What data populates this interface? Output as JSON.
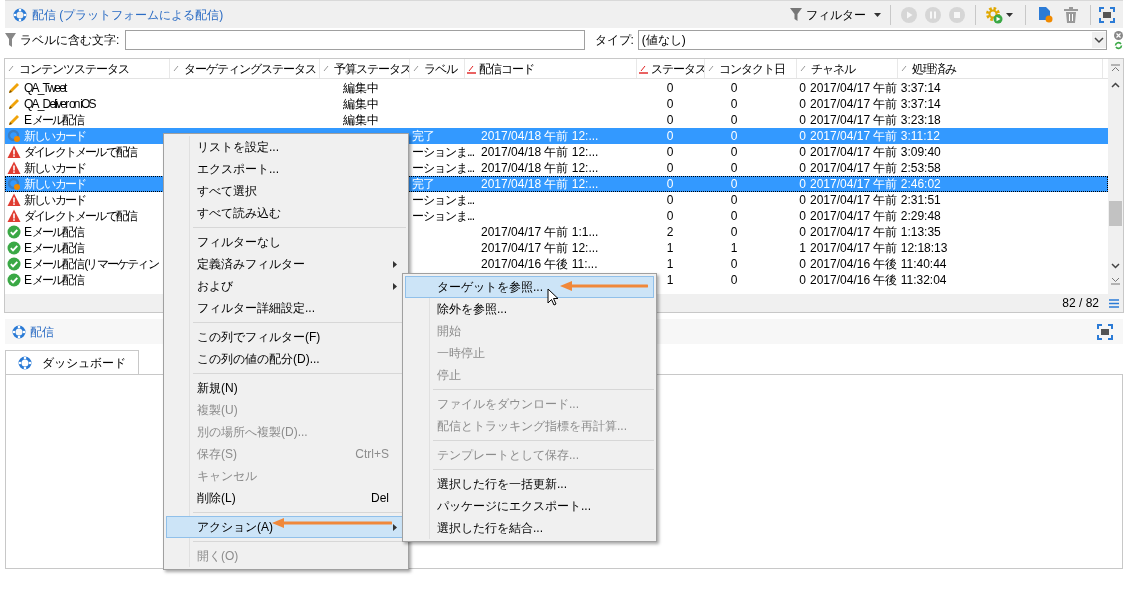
{
  "header": {
    "title": "配信 (プラットフォームによる配信)",
    "filter_button": "フィルター"
  },
  "filter_bar": {
    "text_filter_label": "ラベルに含む文字:",
    "type_filter_label": "タイプ:",
    "type_filter_value": "(値なし)"
  },
  "table": {
    "columns": [
      {
        "label": "コンテンツステータス",
        "sorted": false
      },
      {
        "label": "ターゲティングステータス",
        "sorted": false
      },
      {
        "label": "予算ステータス",
        "sorted": false
      },
      {
        "label": "ラベル",
        "sorted": false
      },
      {
        "label": "配信コード",
        "sorted": true
      },
      {
        "label": "ステータス",
        "sorted": true
      },
      {
        "label": "コンタクト日",
        "sorted": false
      },
      {
        "label": "チャネル",
        "sorted": false
      },
      {
        "label": "処理済み",
        "sorted": false
      }
    ],
    "rows": [
      {
        "kind": "editing",
        "name": "QA_Tweet",
        "budget": "編集中",
        "status": "0",
        "contact": "0",
        "channel": "0",
        "processed": "2017/04/17 午前 3:37:14",
        "selected": false,
        "focused": false
      },
      {
        "kind": "editing",
        "name": "QA_Deliver on iOS",
        "budget": "編集中",
        "status": "0",
        "contact": "0",
        "channel": "0",
        "processed": "2017/04/17 午前 3:37:14",
        "selected": false,
        "focused": false
      },
      {
        "kind": "editing",
        "name": "E メール配信",
        "budget": "編集中",
        "status": "0",
        "contact": "0",
        "channel": "0",
        "processed": "2017/04/17 午前 3:23:18",
        "selected": false,
        "focused": false
      },
      {
        "kind": "targeting",
        "name": "新しいカード",
        "targeting": "完了",
        "code": "2017/04/18 午前 12:...",
        "status": "0",
        "contact": "0",
        "channel": "0",
        "processed": "2017/04/17 午前 3:11:12",
        "selected": true,
        "focused": false
      },
      {
        "kind": "warning",
        "name": "ダイレクトメールで配信",
        "targeting": "ーションま...",
        "code": "2017/04/18 午前 12:...",
        "status": "0",
        "contact": "0",
        "channel": "0",
        "processed": "2017/04/17 午前 3:09:40",
        "selected": false,
        "focused": false
      },
      {
        "kind": "warning",
        "name": "新しいカード",
        "targeting": "ーションま...",
        "code": "2017/04/18 午前 12:...",
        "status": "0",
        "contact": "0",
        "channel": "0",
        "processed": "2017/04/17 午前 2:53:58",
        "selected": false,
        "focused": false
      },
      {
        "kind": "targeting",
        "name": "新しいカード",
        "targeting": "完了",
        "code": "2017/04/18 午前 12:...",
        "status": "0",
        "contact": "0",
        "channel": "0",
        "processed": "2017/04/17 午前 2:46:02",
        "selected": true,
        "focused": true
      },
      {
        "kind": "warning",
        "name": "新しいカード",
        "targeting": "ーションま...",
        "status": "0",
        "contact": "0",
        "channel": "0",
        "processed": "2017/04/17 午前 2:31:51",
        "selected": false,
        "focused": false
      },
      {
        "kind": "warning",
        "name": "ダイレクトメールで配信",
        "targeting": "ーションま...",
        "status": "0",
        "contact": "0",
        "channel": "0",
        "processed": "2017/04/17 午前 2:29:48",
        "selected": false,
        "focused": false
      },
      {
        "kind": "done",
        "name": "E メール配信",
        "code": "2017/04/17 午前 1:1...",
        "status": "2",
        "contact": "0",
        "channel": "0",
        "processed": "2017/04/17 午前 1:13:35",
        "selected": false,
        "focused": false
      },
      {
        "kind": "done",
        "name": "E メール配信",
        "code": "2017/04/17 午前 12:...",
        "status": "1",
        "contact": "1",
        "channel": "1",
        "processed": "2017/04/17 午前 12:18:13",
        "selected": false,
        "focused": false
      },
      {
        "kind": "done",
        "name": "E メール配信 (リマーケティン",
        "code": "2017/04/16 午後 11:...",
        "status": "1",
        "contact": "0",
        "channel": "0",
        "processed": "2017/04/16 午後 11:40:44",
        "selected": false,
        "focused": false
      },
      {
        "kind": "done",
        "name": "E メール配信",
        "status": "1",
        "contact": "0",
        "channel": "0",
        "processed": "2017/04/16 午後 11:32:04",
        "selected": false,
        "focused": false
      }
    ],
    "count": "82 / 82"
  },
  "lower_panel": {
    "title": "配信",
    "tabs": [
      {
        "label": "ダッシュボード",
        "selected": true
      }
    ]
  },
  "context_menu": {
    "items": [
      {
        "kind": "item",
        "label": "リストを設定...",
        "disabled": false,
        "selected": false,
        "submenu": false
      },
      {
        "kind": "item",
        "label": "エクスポート...",
        "disabled": false,
        "selected": false,
        "submenu": false
      },
      {
        "kind": "item",
        "label": "すべて選択",
        "disabled": false,
        "selected": false,
        "submenu": false
      },
      {
        "kind": "item",
        "label": "すべて読み込む",
        "disabled": false,
        "selected": false,
        "submenu": false
      },
      {
        "kind": "separator"
      },
      {
        "kind": "item",
        "label": "フィルターなし",
        "disabled": false,
        "selected": false,
        "submenu": false
      },
      {
        "kind": "item",
        "label": "定義済みフィルター",
        "disabled": false,
        "selected": false,
        "submenu": true
      },
      {
        "kind": "item",
        "label": "および",
        "disabled": false,
        "selected": false,
        "submenu": true
      },
      {
        "kind": "item",
        "label": "フィルター詳細設定...",
        "disabled": false,
        "selected": false,
        "submenu": false
      },
      {
        "kind": "separator"
      },
      {
        "kind": "item",
        "label": "この列でフィルター(F)",
        "disabled": false,
        "selected": false,
        "submenu": false
      },
      {
        "kind": "item",
        "label": "この列の値の配分(D)...",
        "disabled": false,
        "selected": false,
        "submenu": false
      },
      {
        "kind": "separator"
      },
      {
        "kind": "item",
        "label": "新規(N)",
        "disabled": false,
        "selected": false,
        "submenu": false
      },
      {
        "kind": "item",
        "label": "複製(U)",
        "disabled": true,
        "selected": false,
        "submenu": false
      },
      {
        "kind": "item",
        "label": "別の場所へ複製(D)...",
        "disabled": true,
        "selected": false,
        "submenu": false
      },
      {
        "kind": "item",
        "label": "保存(S)",
        "shortcut": "Ctrl+S",
        "disabled": true,
        "selected": false,
        "submenu": false
      },
      {
        "kind": "item",
        "label": "キャンセル",
        "disabled": true,
        "selected": false,
        "submenu": false
      },
      {
        "kind": "item",
        "label": "削除(L)",
        "shortcut": "Del",
        "disabled": false,
        "selected": false,
        "submenu": false
      },
      {
        "kind": "separator"
      },
      {
        "kind": "item",
        "label": "アクション(A)",
        "disabled": false,
        "selected": true,
        "submenu": true
      },
      {
        "kind": "separator"
      },
      {
        "kind": "item",
        "label": "開く(O)",
        "disabled": true,
        "selected": false,
        "submenu": false
      }
    ]
  },
  "submenu": {
    "items": [
      {
        "kind": "item",
        "label": "ターゲットを参照...",
        "disabled": false,
        "selected": true
      },
      {
        "kind": "item",
        "label": "除外を参照...",
        "disabled": false,
        "selected": false
      },
      {
        "kind": "item",
        "label": "開始",
        "disabled": true,
        "selected": false
      },
      {
        "kind": "item",
        "label": "一時停止",
        "disabled": true,
        "selected": false
      },
      {
        "kind": "item",
        "label": "停止",
        "disabled": true,
        "selected": false
      },
      {
        "kind": "separator"
      },
      {
        "kind": "item",
        "label": "ファイルをダウンロード...",
        "disabled": true,
        "selected": false
      },
      {
        "kind": "item",
        "label": "配信とトラッキング指標を再計算...",
        "disabled": true,
        "selected": false
      },
      {
        "kind": "separator"
      },
      {
        "kind": "item",
        "label": "テンプレートとして保存...",
        "disabled": true,
        "selected": false
      },
      {
        "kind": "separator"
      },
      {
        "kind": "item",
        "label": "選択した行を一括更新...",
        "disabled": false,
        "selected": false
      },
      {
        "kind": "item",
        "label": "パッケージにエクスポート...",
        "disabled": false,
        "selected": false
      },
      {
        "kind": "item",
        "label": "選択した行を結合...",
        "disabled": false,
        "selected": false
      }
    ]
  }
}
